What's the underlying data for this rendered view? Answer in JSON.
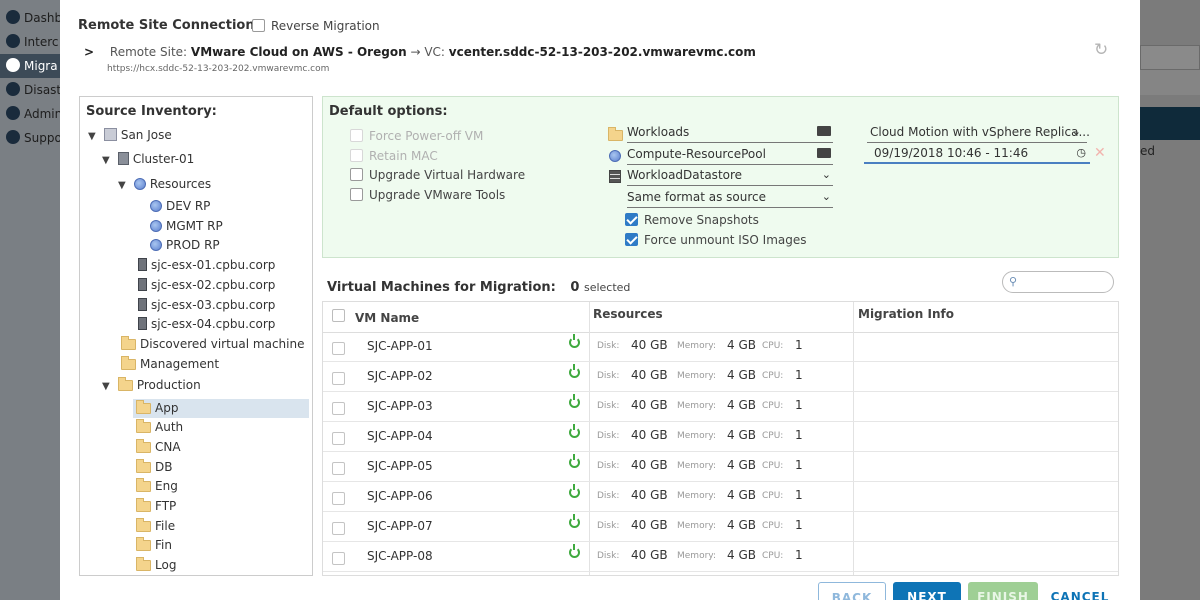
{
  "background_nav": {
    "items": [
      "Dashb",
      "Interc",
      "Migra",
      "Disast",
      "Admin",
      "Suppo"
    ],
    "right_text": "ed"
  },
  "header": {
    "remote_site_connection_label": "Remote Site Connection:",
    "reverse_migration_label": "Reverse Migration",
    "reverse_migration_checked": false,
    "remote_site_prefix": "Remote Site:",
    "remote_site_name": "VMware Cloud on AWS - Oregon",
    "arrow": "→",
    "vc_prefix": "VC:",
    "vc_name": "vcenter.sddc-52-13-203-202.vmwarevmc.com",
    "remote_url": "https://hcx.sddc-52-13-203-202.vmwarevmc.com"
  },
  "inventory": {
    "title": "Source Inventory:",
    "nodes": [
      {
        "label": "San Jose",
        "icon": "datacenter-icon",
        "expanded": true
      },
      {
        "label": "Cluster-01",
        "icon": "cluster-icon",
        "expanded": true
      },
      {
        "label": "Resources",
        "icon": "resource-pool-icon",
        "expanded": true
      },
      {
        "label": "DEV RP",
        "icon": "resource-pool-icon"
      },
      {
        "label": "MGMT RP",
        "icon": "resource-pool-icon"
      },
      {
        "label": "PROD RP",
        "icon": "resource-pool-icon"
      },
      {
        "label": "sjc-esx-01.cpbu.corp",
        "icon": "host-icon"
      },
      {
        "label": "sjc-esx-02.cpbu.corp",
        "icon": "host-icon"
      },
      {
        "label": "sjc-esx-03.cpbu.corp",
        "icon": "host-icon"
      },
      {
        "label": "sjc-esx-04.cpbu.corp",
        "icon": "host-icon"
      },
      {
        "label": "Discovered virtual machine",
        "icon": "folder-icon"
      },
      {
        "label": "Management",
        "icon": "folder-icon"
      },
      {
        "label": "Production",
        "icon": "folder-icon",
        "expanded": true
      },
      {
        "label": "App",
        "icon": "folder-icon",
        "selected": true
      },
      {
        "label": "Auth",
        "icon": "folder-icon"
      },
      {
        "label": "CNA",
        "icon": "folder-icon"
      },
      {
        "label": "DB",
        "icon": "folder-icon"
      },
      {
        "label": "Eng",
        "icon": "folder-icon"
      },
      {
        "label": "FTP",
        "icon": "folder-icon"
      },
      {
        "label": "File",
        "icon": "folder-icon"
      },
      {
        "label": "Fin",
        "icon": "folder-icon"
      },
      {
        "label": "Log",
        "icon": "folder-icon"
      }
    ]
  },
  "default_options": {
    "title": "Default options:",
    "checkboxes": [
      {
        "label": "Force Power-off VM",
        "checked": false,
        "disabled": true
      },
      {
        "label": "Retain MAC",
        "checked": false,
        "disabled": true
      },
      {
        "label": "Upgrade Virtual Hardware",
        "checked": false,
        "disabled": false
      },
      {
        "label": "Upgrade VMware Tools",
        "checked": false,
        "disabled": false
      }
    ],
    "folder": "Workloads",
    "resource_pool": "Compute-ResourcePool",
    "datastore": "WorkloadDatastore",
    "disk_format": "Same format as source",
    "remove_snapshots_label": "Remove Snapshots",
    "remove_snapshots_checked": true,
    "force_unmount_label": "Force unmount ISO Images",
    "force_unmount_checked": true,
    "migration_type": "Cloud Motion with vSphere Replica...",
    "schedule": "09/19/2018 10:46 - 11:46"
  },
  "vm_table": {
    "title": "Virtual Machines for Migration:",
    "selected_count": "0",
    "selected_label": "selected",
    "search_placeholder": "",
    "columns": {
      "name": "VM Name",
      "resources": "Resources",
      "migration_info": "Migration Info"
    },
    "labels": {
      "disk": "Disk:",
      "memory": "Memory:",
      "cpu": "CPU:"
    },
    "rows": [
      {
        "name": "SJC-APP-01",
        "disk": "40 GB",
        "memory": "4 GB",
        "cpu": "1"
      },
      {
        "name": "SJC-APP-02",
        "disk": "40 GB",
        "memory": "4 GB",
        "cpu": "1"
      },
      {
        "name": "SJC-APP-03",
        "disk": "40 GB",
        "memory": "4 GB",
        "cpu": "1"
      },
      {
        "name": "SJC-APP-04",
        "disk": "40 GB",
        "memory": "4 GB",
        "cpu": "1"
      },
      {
        "name": "SJC-APP-05",
        "disk": "40 GB",
        "memory": "4 GB",
        "cpu": "1"
      },
      {
        "name": "SJC-APP-06",
        "disk": "40 GB",
        "memory": "4 GB",
        "cpu": "1"
      },
      {
        "name": "SJC-APP-07",
        "disk": "40 GB",
        "memory": "4 GB",
        "cpu": "1"
      },
      {
        "name": "SJC-APP-08",
        "disk": "40 GB",
        "memory": "4 GB",
        "cpu": "1"
      }
    ]
  },
  "footer": {
    "back_label": "BACK",
    "next_label": "NEXT",
    "finish_label": "FINISH",
    "cancel_label": "CANCEL"
  },
  "colors": {
    "accent": "#0e74b6",
    "options_bg": "#effbef",
    "power_on": "#3faa3f",
    "finish_disabled": "#9fcf95"
  }
}
